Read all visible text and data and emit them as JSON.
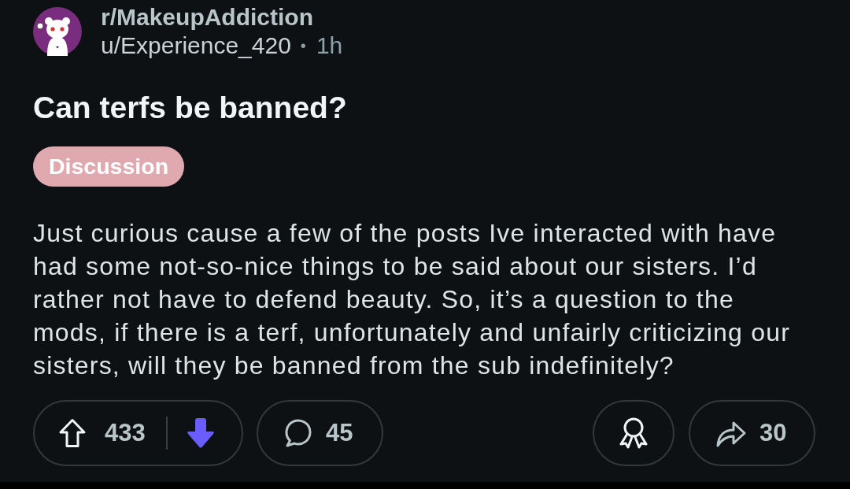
{
  "post": {
    "subreddit": "r/MakeupAddiction",
    "author": "u/Experience_420",
    "separator": "•",
    "age": "1h",
    "title": "Can terfs be banned?",
    "flair": "Discussion",
    "body": "Just curious cause a few of the posts Ive interacted with have had some not-so-nice things to be said about our sisters. I’d rather not have to defend beauty. So, it’s a question to the mods, if there is a terf, unfortunately and unfairly criticizing our sisters, will they be banned from the sub indefinitely?"
  },
  "actions": {
    "vote": {
      "score": "433",
      "upvoted": false,
      "downvoted": true
    },
    "comments": "45",
    "shares": "30"
  }
}
